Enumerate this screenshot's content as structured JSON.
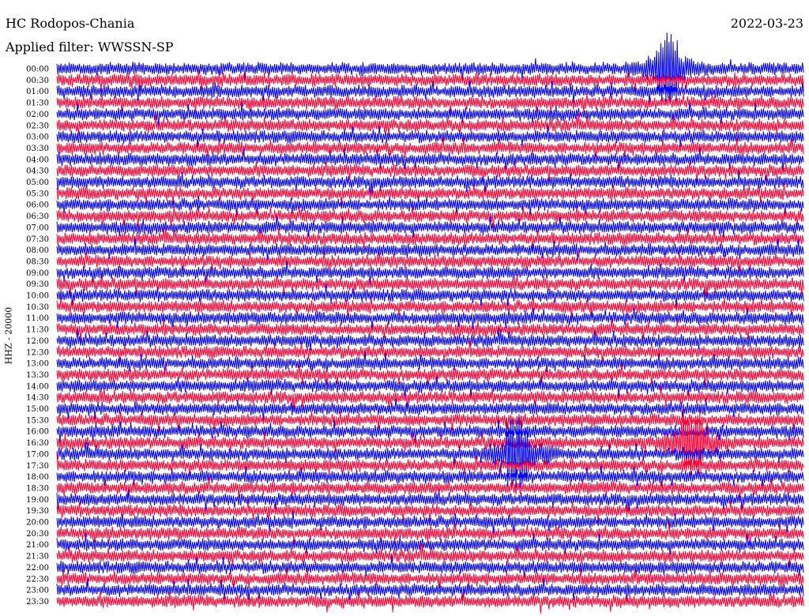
{
  "header": {
    "station": "HC Rodopos-Chania",
    "filter": "Applied filter: WWSSN-SP",
    "date": "2022-03-23"
  },
  "channel_label": "HHZ - 20000",
  "colors": {
    "trace_a": "#0000ff",
    "trace_b": "#ff0033",
    "background": "#ffffff"
  },
  "chart_data": {
    "type": "line",
    "title": "",
    "xlabel": "",
    "ylabel": "HHZ - 20000",
    "rows": [
      "00:00",
      "00:30",
      "01:00",
      "01:30",
      "02:00",
      "02:30",
      "03:00",
      "03:30",
      "04:00",
      "04:30",
      "05:00",
      "05:30",
      "06:00",
      "06:30",
      "07:00",
      "07:30",
      "08:00",
      "08:30",
      "09:00",
      "09:30",
      "10:00",
      "10:30",
      "11:00",
      "11:30",
      "12:00",
      "12:30",
      "13:00",
      "13:30",
      "14:00",
      "14:30",
      "15:00",
      "15:30",
      "16:00",
      "16:30",
      "17:00",
      "17:30",
      "18:00",
      "18:30",
      "19:00",
      "19:30",
      "20:00",
      "20:30",
      "21:00",
      "21:30",
      "22:00",
      "22:30",
      "23:00",
      "23:30"
    ],
    "row_duration_minutes": 30,
    "row_colors": [
      "#0000ff",
      "#ff0033"
    ],
    "amplitude": "clipped",
    "events": [
      {
        "row": "00:00",
        "minute_in_row": 24.5,
        "note": "large amplitude"
      },
      {
        "row": "16:30",
        "minute_in_row": 25.5,
        "note": "large amplitude"
      },
      {
        "row": "17:00",
        "minute_in_row": 18.5,
        "note": "large amplitude"
      }
    ]
  }
}
